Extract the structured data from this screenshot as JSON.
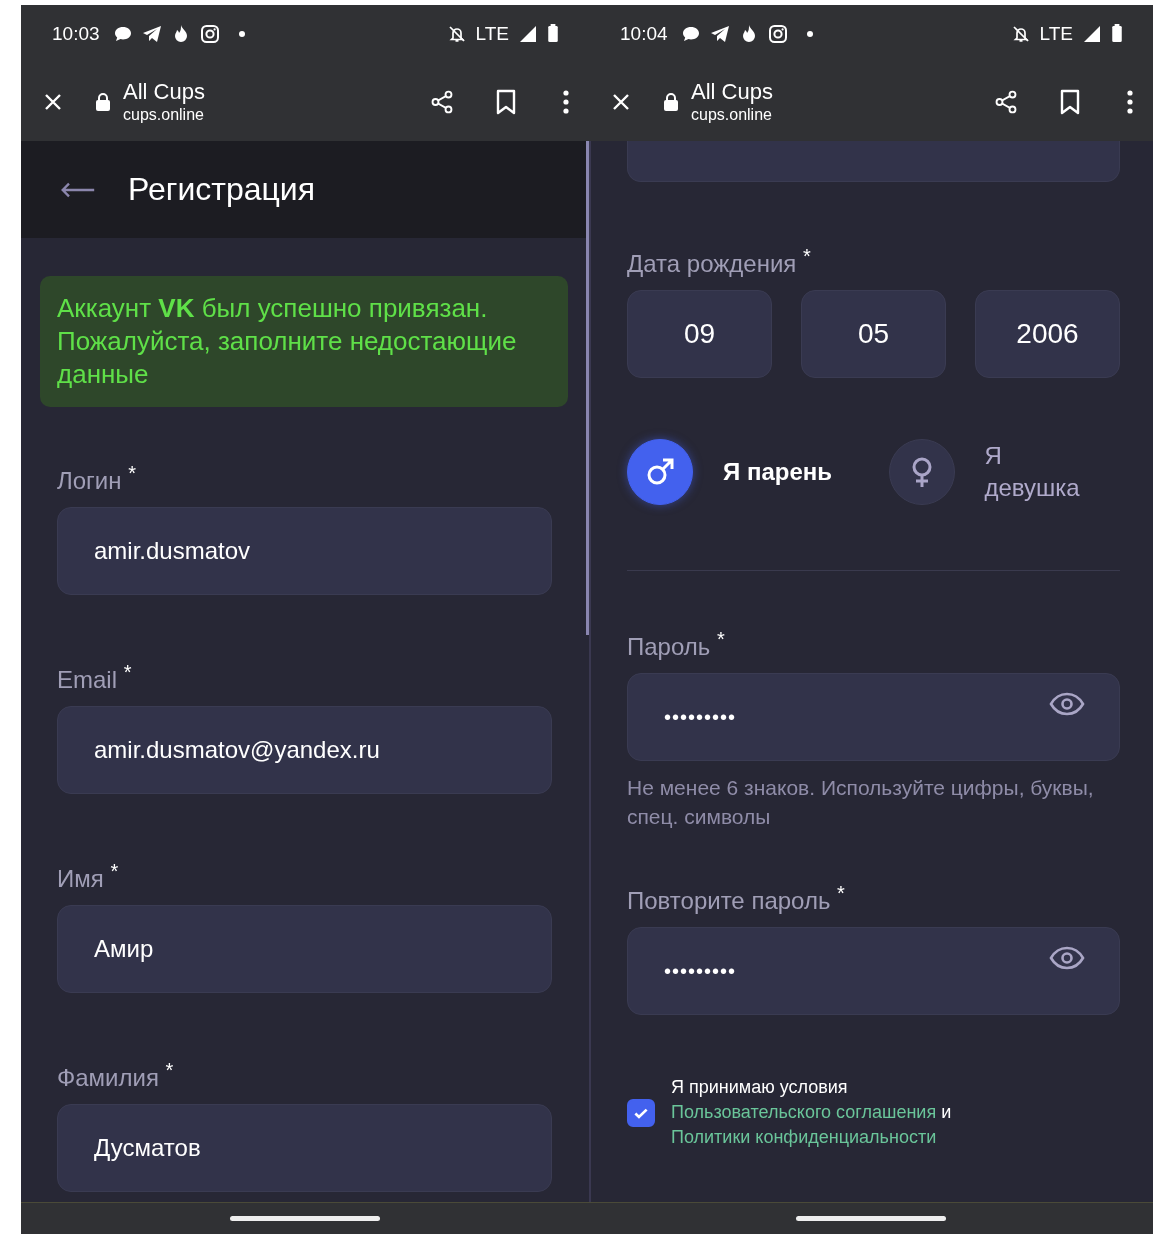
{
  "phones": [
    {
      "status_bar": {
        "time": "10:03",
        "network": "LTE"
      },
      "browser_bar": {
        "title": "All Cups",
        "url": "cups.online"
      },
      "page": {
        "kind": "form-top",
        "header": {
          "title": "Регистрация"
        },
        "alert": {
          "text": "Аккаунт **VK** был успешно привязан. Пожалуйста, заполните недостающие данные"
        },
        "fields": [
          {
            "label": "Логин $^{*}$",
            "value": "amir.dusmatov"
          },
          {
            "label": "Email $^{*}$",
            "value": "amir.dusmatov@yandex.ru"
          },
          {
            "label": "Имя $^{*}$",
            "value": "Амир"
          },
          {
            "label": "Фамилия $^{*}$",
            "value": "Дусматов"
          }
        ]
      }
    },
    {
      "status_bar": {
        "time": "10:04",
        "network": "LTE"
      },
      "browser_bar": {
        "title": "All Cups",
        "url": "cups.online"
      },
      "page": {
        "kind": "form-bottom",
        "birth_date": {
          "label": "Дата рождения $^{*}$",
          "parts": [
            "09",
            "05",
            "2006"
          ]
        },
        "gender": [
          {
            "kind": "male",
            "label": "Я парень",
            "selected": true
          },
          {
            "kind": "female",
            "label": "Я девушка",
            "selected": false
          }
        ],
        "password_fields": [
          {
            "label": "Пароль $^{*}$",
            "value": "•••••••••",
            "hint": "Не менее 6 знаков. Используйте цифры, буквы, спец. символы"
          },
          {
            "label": "Повторите пароль $^{*}$",
            "value": "•••••••••"
          }
        ],
        "terms": {
          "checked": true,
          "text": "Я принимаю условия",
          "link_1": "Пользовательского соглашения",
          "joiner": "и",
          "link_2": "Политики конфиденциальности"
        }
      }
    }
  ]
}
